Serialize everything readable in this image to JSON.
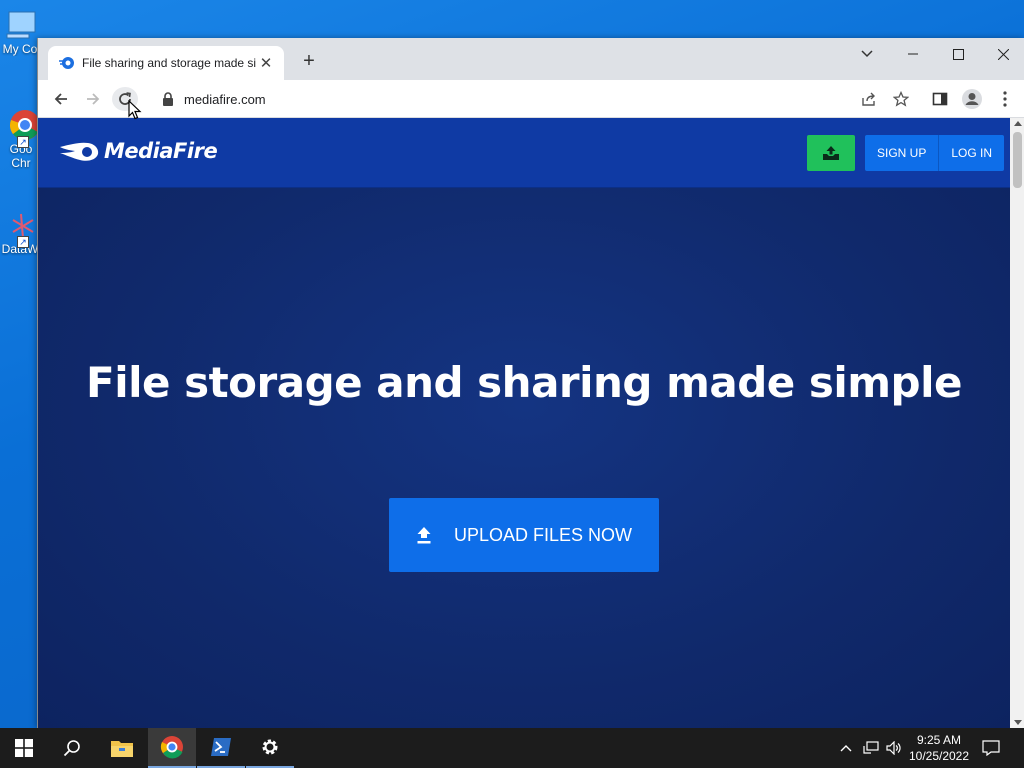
{
  "desktop": {
    "icons": [
      {
        "name": "my-computer",
        "label": "My Co"
      },
      {
        "name": "google-chrome",
        "label": "Goo Chr"
      },
      {
        "name": "datawrapper",
        "label": "DataW"
      }
    ]
  },
  "browser": {
    "tab": {
      "title": "File sharing and storage made si"
    },
    "address": "mediafire.com"
  },
  "site": {
    "logo_text": "MediaFire",
    "signup_label": "SIGN UP",
    "login_label": "LOG IN",
    "hero_title": "File storage and sharing made simple",
    "upload_label": "UPLOAD FILES NOW"
  },
  "taskbar": {
    "time": "9:25 AM",
    "date": "10/25/2022"
  },
  "colors": {
    "header_blue": "#0f3aa4",
    "hero_blue": "#10296b",
    "button_blue": "#0e6ee9",
    "upload_green": "#20c15b"
  }
}
